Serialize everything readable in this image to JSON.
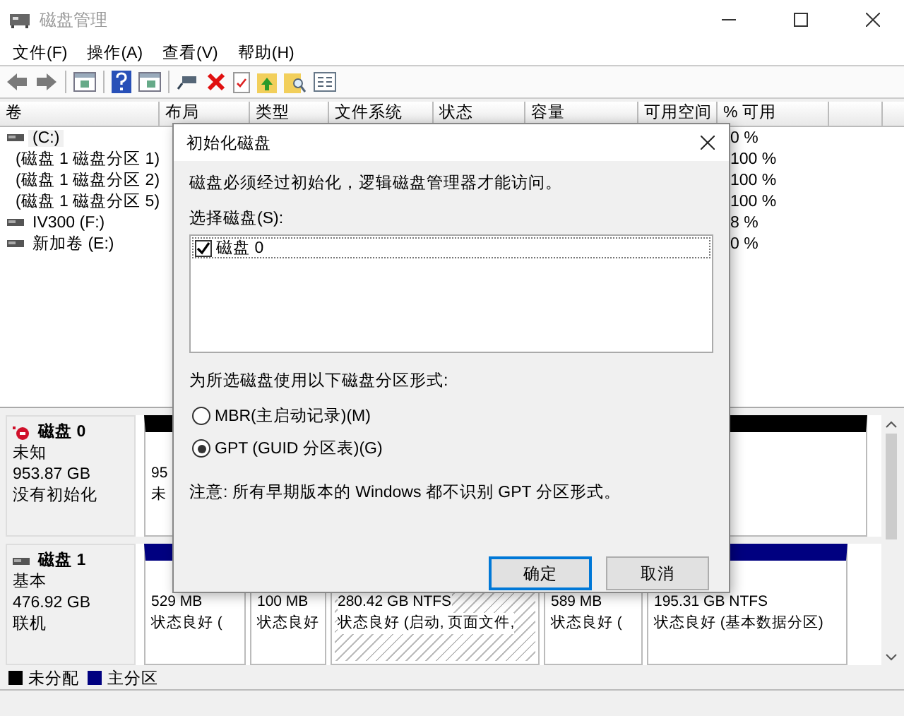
{
  "window": {
    "title": "磁盘管理"
  },
  "menu": [
    "文件(F)",
    "操作(A)",
    "查看(V)",
    "帮助(H)"
  ],
  "volume_table": {
    "columns": [
      "卷",
      "布局",
      "类型",
      "文件系统",
      "状态",
      "容量",
      "可用空间",
      "% 可用"
    ],
    "rows": [
      {
        "volume": "(C:)",
        "free_percent": "0 %",
        "selected": true
      },
      {
        "volume": "(磁盘 1 磁盘分区 1)",
        "free_percent": "100 %",
        "selected": false
      },
      {
        "volume": "(磁盘 1 磁盘分区 2)",
        "free_percent": "100 %",
        "selected": false
      },
      {
        "volume": "(磁盘 1 磁盘分区 5)",
        "free_percent": "100 %",
        "selected": false
      },
      {
        "volume": "IV300 (F:)",
        "free_percent": "8 %",
        "selected": false
      },
      {
        "volume": "新加卷 (E:)",
        "free_percent": "0 %",
        "selected": false
      }
    ]
  },
  "disks": [
    {
      "name": "磁盘 0",
      "kind": "uninitialized",
      "type": "未知",
      "size": "953.87 GB",
      "status": "没有初始化",
      "partitions": [
        {
          "kind": "unallocated",
          "size": "95",
          "status": "未",
          "selected": false
        }
      ]
    },
    {
      "name": "磁盘 1",
      "kind": "basic",
      "type": "基本",
      "size": "476.92 GB",
      "status": "联机",
      "partitions": [
        {
          "kind": "primary",
          "size": "529 MB",
          "status": "状态良好 (",
          "selected": false
        },
        {
          "kind": "primary",
          "size": "100 MB",
          "status": "状态良好",
          "selected": false
        },
        {
          "kind": "primary",
          "size": "280.42 GB NTFS",
          "status": "状态良好 (启动, 页面文件,",
          "selected": true
        },
        {
          "kind": "primary",
          "size": "589 MB",
          "status": "状态良好 (",
          "selected": false
        },
        {
          "kind": "primary",
          "size": "195.31 GB NTFS",
          "status": "状态良好 (基本数据分区)",
          "selected": false
        }
      ]
    }
  ],
  "legend": [
    {
      "label": "未分配",
      "color": "#000000"
    },
    {
      "label": "主分区",
      "color": "#000080"
    }
  ],
  "dialog": {
    "title": "初始化磁盘",
    "message": "磁盘必须经过初始化，逻辑磁盘管理器才能访问。",
    "select_label": "选择磁盘(S):",
    "disks": [
      {
        "label": "磁盘 0",
        "checked": true
      }
    ],
    "style_label": "为所选磁盘使用以下磁盘分区形式:",
    "styles": [
      {
        "label": "MBR(主启动记录)(M)",
        "selected": false
      },
      {
        "label": "GPT (GUID 分区表)(G)",
        "selected": true
      }
    ],
    "note": "注意: 所有早期版本的 Windows 都不识别 GPT 分区形式。",
    "buttons": [
      {
        "label": "确定",
        "default": true
      },
      {
        "label": "取消",
        "default": false
      }
    ]
  }
}
